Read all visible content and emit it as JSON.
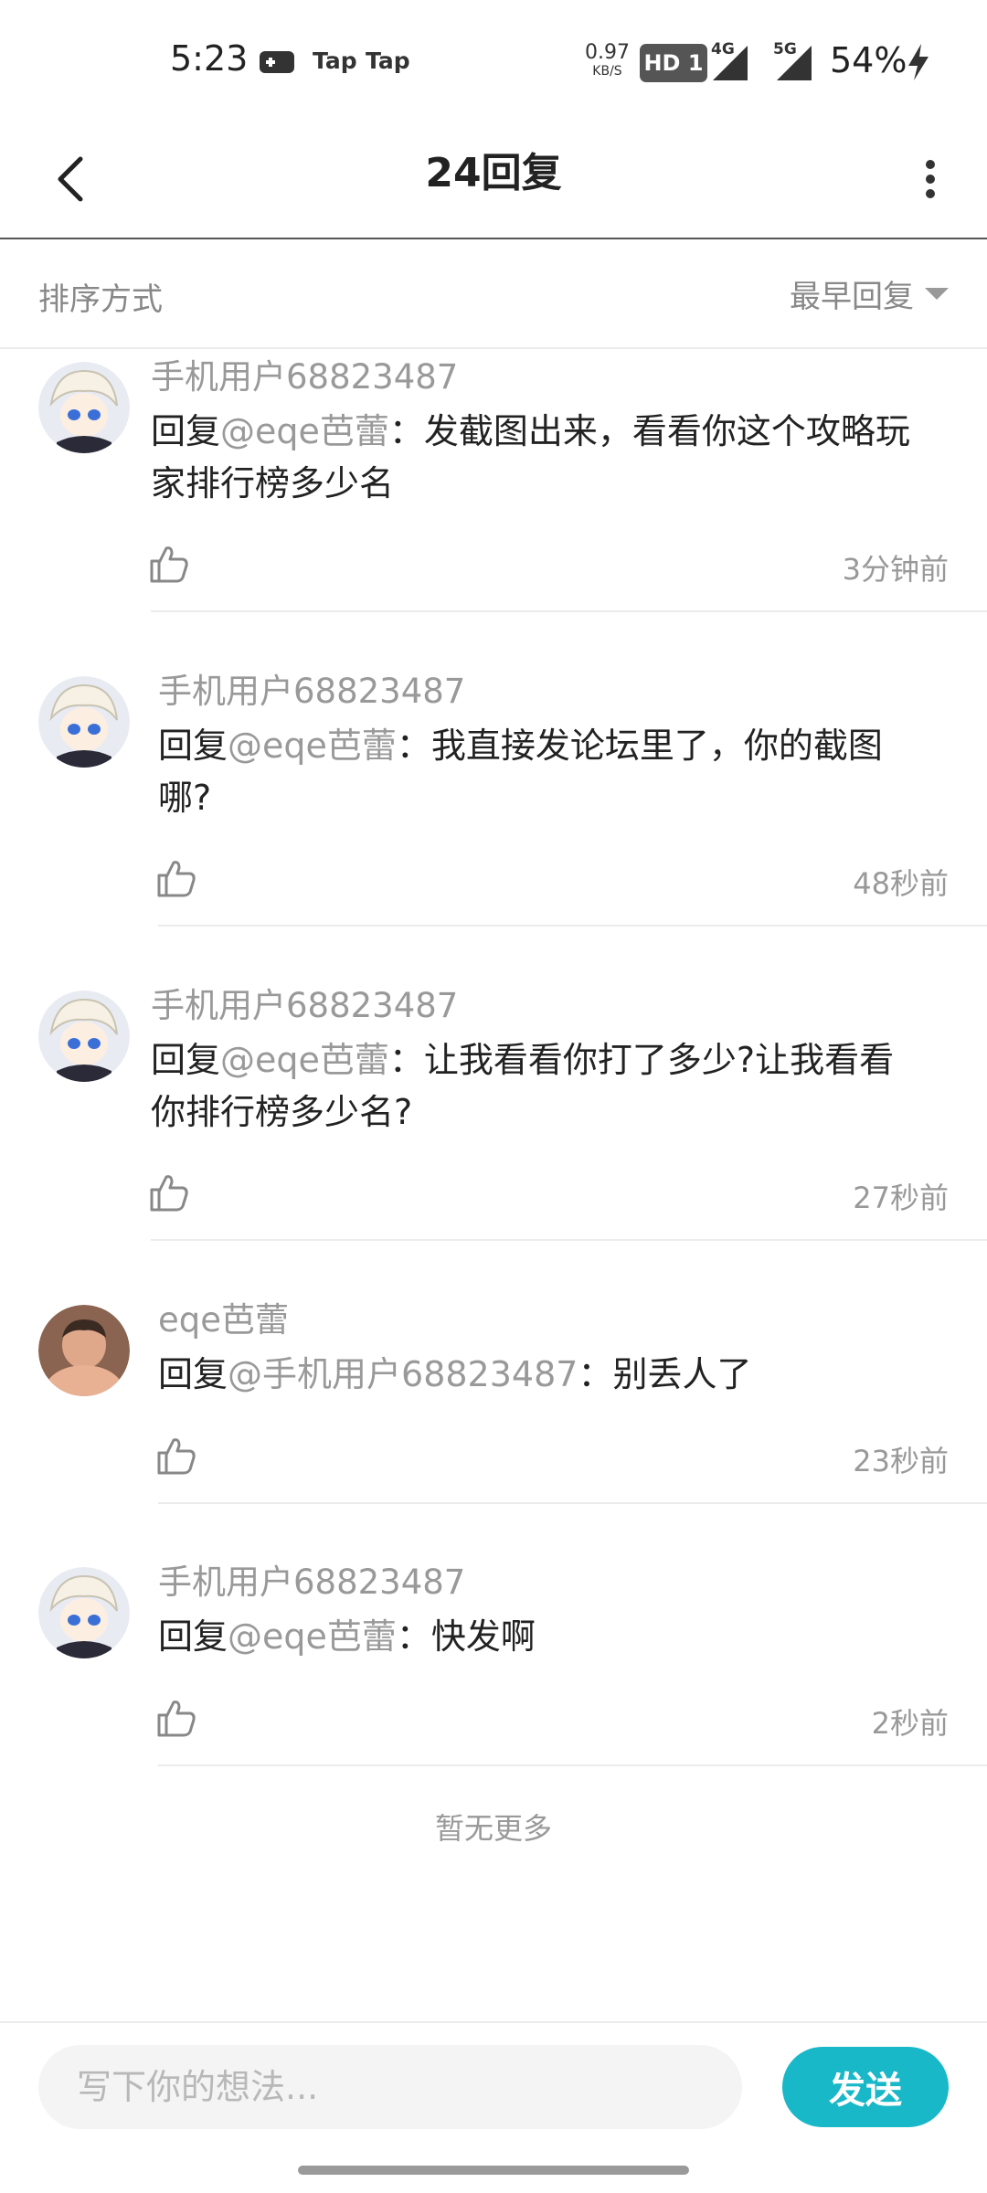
{
  "status_bar": {
    "time": "5:23",
    "app_tag_1": "Tap",
    "app_tag_2": "Tap",
    "net_speed": "0.97",
    "net_unit": "KB/S",
    "hd_label": "HD 1",
    "network_1": "4G",
    "network_2": "5G",
    "battery": "54%"
  },
  "header": {
    "title": "24回复",
    "back_icon": "chevron-left-icon",
    "more_icon": "vertical-dots-icon"
  },
  "sort": {
    "label": "排序方式",
    "value": "最早回复"
  },
  "comments": [
    {
      "user": "手机用户68823487",
      "reply_prefix": "回复",
      "mention": "@eqe芭蕾",
      "text": "：发截图出来，看看你这个攻略玩家排行榜多少名",
      "time": "3分钟前",
      "avatar": "anime-avatar"
    },
    {
      "user": "手机用户68823487",
      "reply_prefix": "回复",
      "mention": "@eqe芭蕾",
      "text": "：我直接发论坛里了，你的截图哪?",
      "time": "48秒前",
      "avatar": "anime-avatar"
    },
    {
      "user": "手机用户68823487",
      "reply_prefix": "回复",
      "mention": "@eqe芭蕾",
      "text": "：让我看看你打了多少?让我看看你排行榜多少名?",
      "time": "27秒前",
      "avatar": "anime-avatar"
    },
    {
      "user": "eqe芭蕾",
      "reply_prefix": "回复",
      "mention": "@手机用户68823487",
      "text": "：别丢人了",
      "time": "23秒前",
      "avatar": "photo-avatar"
    },
    {
      "user": "手机用户68823487",
      "reply_prefix": "回复",
      "mention": "@eqe芭蕾",
      "text": "：快发啊",
      "time": "2秒前",
      "avatar": "anime-avatar"
    }
  ],
  "footer_note": "暂无更多",
  "composer": {
    "placeholder": "写下你的想法...",
    "send_label": "发送"
  },
  "colors": {
    "accent": "#18b8c8",
    "muted_text": "#999999",
    "divider": "#ececec"
  }
}
